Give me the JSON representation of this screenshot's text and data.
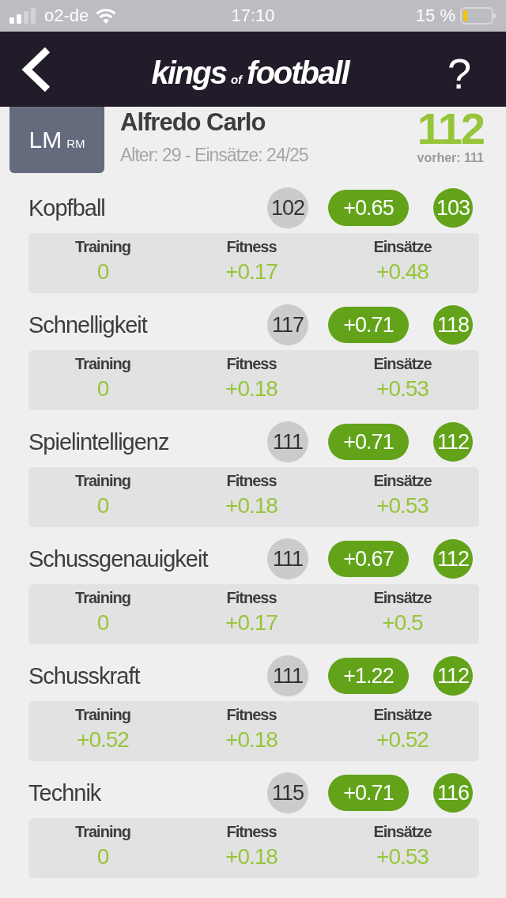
{
  "status_bar": {
    "carrier": "o2-de",
    "time": "17:10",
    "battery": "15 %"
  },
  "header": {
    "logo": {
      "first": "kings",
      "middle": "of",
      "last": "football"
    },
    "help": "?"
  },
  "player": {
    "position": "LM",
    "alt_position": "RM",
    "name": "Alfredo Carlo",
    "info": "Alter: 29 - Einsätze: 24/25",
    "rating": "112",
    "previous": "vorher: 111"
  },
  "attributes": [
    {
      "name": "Kopfball",
      "old": "102",
      "change": "+0.65",
      "new": "103",
      "breakdown": [
        {
          "label": "Training",
          "value": "0"
        },
        {
          "label": "Fitness",
          "value": "+0.17"
        },
        {
          "label": "Einsätze",
          "value": "+0.48"
        }
      ]
    },
    {
      "name": "Schnelligkeit",
      "old": "117",
      "change": "+0.71",
      "new": "118",
      "breakdown": [
        {
          "label": "Training",
          "value": "0"
        },
        {
          "label": "Fitness",
          "value": "+0.18"
        },
        {
          "label": "Einsätze",
          "value": "+0.53"
        }
      ]
    },
    {
      "name": "Spielintelligenz",
      "old": "111",
      "change": "+0.71",
      "new": "112",
      "breakdown": [
        {
          "label": "Training",
          "value": "0"
        },
        {
          "label": "Fitness",
          "value": "+0.18"
        },
        {
          "label": "Einsätze",
          "value": "+0.53"
        }
      ]
    },
    {
      "name": "Schussgenauigkeit",
      "old": "111",
      "change": "+0.67",
      "new": "112",
      "breakdown": [
        {
          "label": "Training",
          "value": "0"
        },
        {
          "label": "Fitness",
          "value": "+0.17"
        },
        {
          "label": "Einsätze",
          "value": "+0.5"
        }
      ]
    },
    {
      "name": "Schusskraft",
      "old": "111",
      "change": "+1.22",
      "new": "112",
      "breakdown": [
        {
          "label": "Training",
          "value": "+0.52"
        },
        {
          "label": "Fitness",
          "value": "+0.18"
        },
        {
          "label": "Einsätze",
          "value": "+0.52"
        }
      ]
    },
    {
      "name": "Technik",
      "old": "115",
      "change": "+0.71",
      "new": "116",
      "breakdown": [
        {
          "label": "Training",
          "value": "0"
        },
        {
          "label": "Fitness",
          "value": "+0.18"
        },
        {
          "label": "Einsätze",
          "value": "+0.53"
        }
      ]
    }
  ]
}
